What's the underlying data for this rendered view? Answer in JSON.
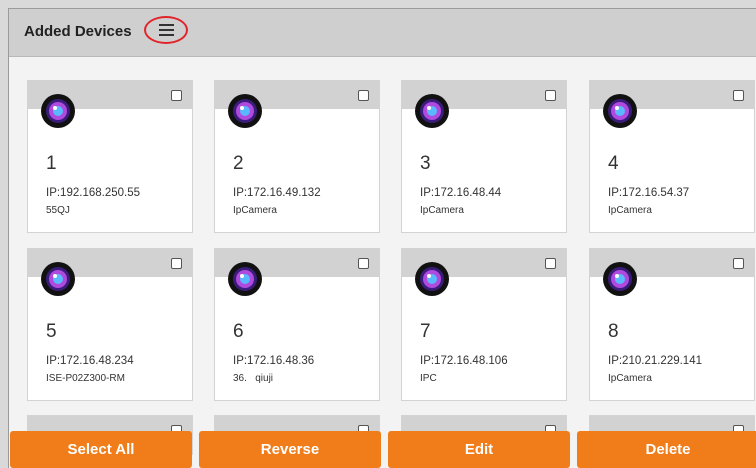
{
  "header": {
    "title": "Added Devices",
    "menu_icon": "hamburger-menu-icon"
  },
  "devices": [
    {
      "number": "1",
      "ip": "IP:192.168.250.55",
      "name": "55QJ"
    },
    {
      "number": "2",
      "ip": "IP:172.16.49.132",
      "name": "IpCamera"
    },
    {
      "number": "3",
      "ip": "IP:172.16.48.44",
      "name": "IpCamera"
    },
    {
      "number": "4",
      "ip": "IP:172.16.54.37",
      "name": "IpCamera"
    },
    {
      "number": "5",
      "ip": "IP:172.16.48.234",
      "name": "ISE-P02Z300-RM"
    },
    {
      "number": "6",
      "ip": "IP:172.16.48.36",
      "name": "36.   qiuji"
    },
    {
      "number": "7",
      "ip": "IP:172.16.48.106",
      "name": "IPC"
    },
    {
      "number": "8",
      "ip": "IP:210.21.229.141",
      "name": "IpCamera"
    }
  ],
  "device_icon": "camera-lens-icon",
  "actions": {
    "select_all": "Select All",
    "reverse": "Reverse",
    "edit": "Edit",
    "delete": "Delete"
  },
  "colors": {
    "accent": "#f07d1a",
    "header_bg": "#cfcfcf",
    "highlight_ring": "#e0242a"
  }
}
